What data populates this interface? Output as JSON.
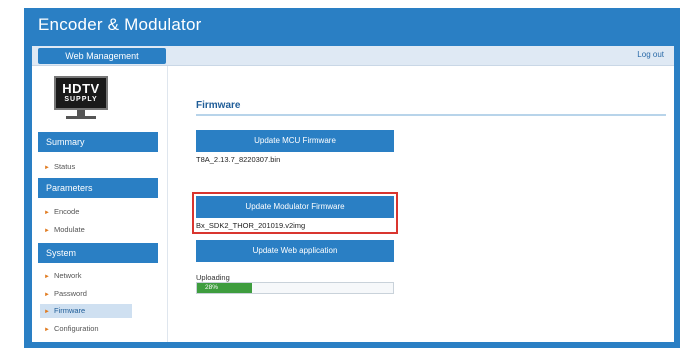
{
  "app": {
    "title": "Encoder & Modulator"
  },
  "topbar": {
    "section_label": "Web Management",
    "logout_label": "Log out"
  },
  "logo": {
    "line1": "HDTV",
    "line2": "SUPPLY"
  },
  "sidebar": {
    "summary": {
      "label": "Summary",
      "items": [
        {
          "label": "Status",
          "active": false
        }
      ]
    },
    "parameters": {
      "label": "Parameters",
      "items": [
        {
          "label": "Encode",
          "active": false
        },
        {
          "label": "Modulate",
          "active": false
        }
      ]
    },
    "system": {
      "label": "System",
      "items": [
        {
          "label": "Network",
          "active": false
        },
        {
          "label": "Password",
          "active": false
        },
        {
          "label": "Firmware",
          "active": true
        },
        {
          "label": "Configuration",
          "active": false
        }
      ]
    }
  },
  "main": {
    "title": "Firmware",
    "mcu": {
      "button": "Update MCU Firmware",
      "filename": "T8A_2.13.7_8220307.bin"
    },
    "modulator": {
      "button": "Update Modulator Firmware",
      "filename": "Bx_SDK2_THOR_201019.v2img"
    },
    "web": {
      "button": "Update Web application"
    },
    "upload": {
      "label": "Uploading",
      "percent_text": "28%",
      "fraction": 0.28
    }
  },
  "colors": {
    "accent": "#2a7fc4",
    "highlight": "#d9352f",
    "progress": "#3e9d3e",
    "active_item": "#cfe0f1"
  }
}
